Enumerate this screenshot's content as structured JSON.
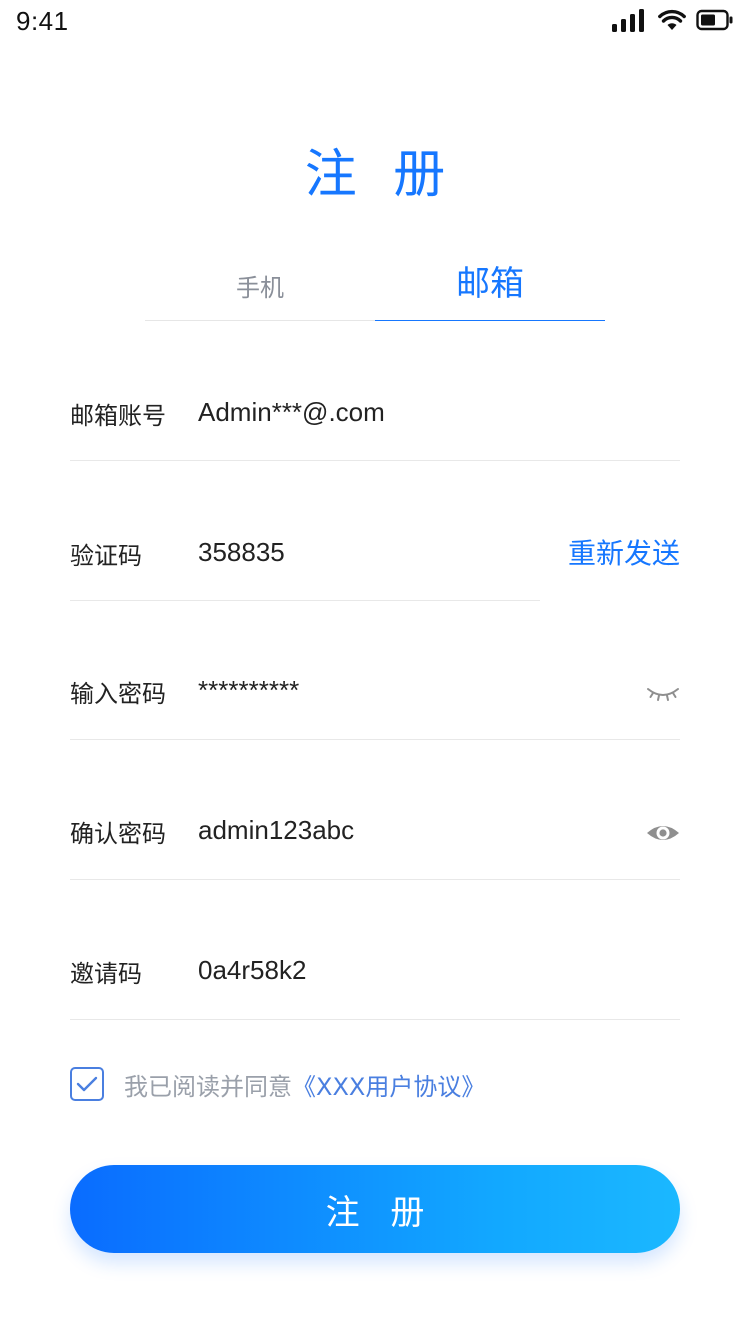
{
  "status_bar": {
    "time": "9:41",
    "icons": [
      "signal-icon",
      "wifi-icon",
      "battery-icon"
    ]
  },
  "title": "注 册",
  "tabs": [
    {
      "label": "手机",
      "active": false
    },
    {
      "label": "邮箱",
      "active": true
    }
  ],
  "form": {
    "email": {
      "label": "邮箱账号",
      "value": "Admin***@.com"
    },
    "code": {
      "label": "验证码",
      "value": "358835",
      "resend_label": "重新发送"
    },
    "password": {
      "label": "输入密码",
      "value": "**********",
      "toggle_icon": "eye-closed-icon"
    },
    "confirm": {
      "label": "确认密码",
      "value": "admin123abc",
      "toggle_icon": "eye-open-icon"
    },
    "invite": {
      "label": "邀请码",
      "value": "0a4r58k2"
    }
  },
  "agreement": {
    "checked": true,
    "text": "我已阅读并同意",
    "link": "《XXX用户协议》"
  },
  "submit_label": "注 册",
  "colors": {
    "accent": "#1677ff",
    "label": "#222222",
    "muted": "#9aa0aa",
    "divider": "#e8e8e8"
  }
}
